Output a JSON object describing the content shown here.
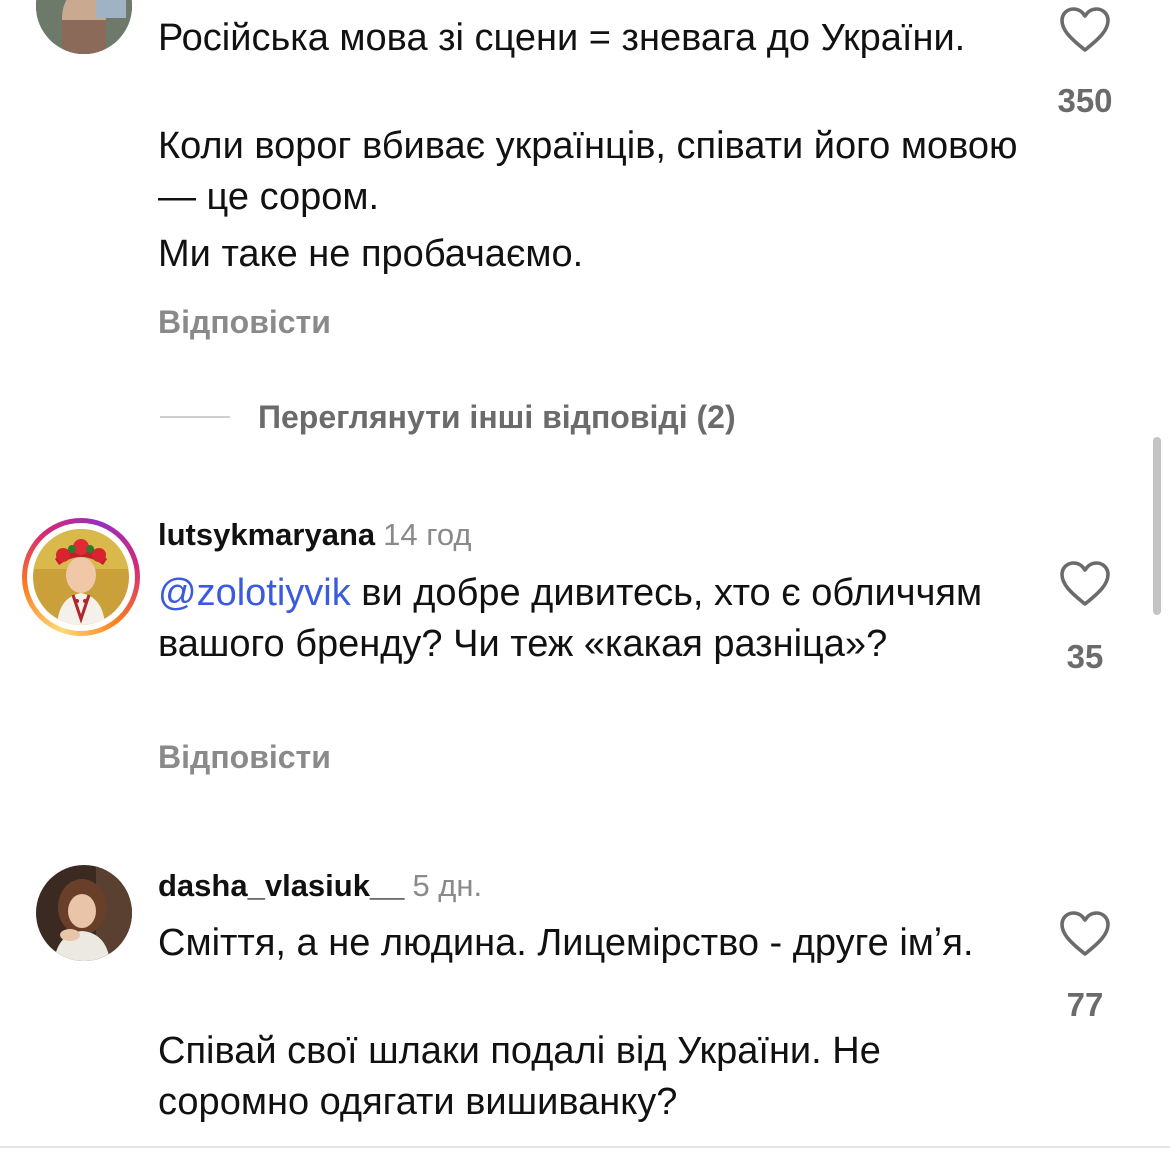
{
  "comments": [
    {
      "username": "",
      "time": "",
      "paragraphs": [
        "Російська мова зі сцени = зневага до України.",
        "Коли ворог вбиває українців, співати його мовою — це сором.",
        "Ми таке не пробачаємо."
      ],
      "reply_label": "Відповісти",
      "likes": "350",
      "like_icon": "heart-outline-icon",
      "view_replies": "Переглянути інші відповіді (2)"
    },
    {
      "username": "lutsykmaryana",
      "time": "14 год",
      "mention": "@zolotiyvik",
      "paragraphs": [
        " ви добре дивитесь, хто є обличчям вашого бренду? Чи теж «какая разніца»?"
      ],
      "reply_label": "Відповісти",
      "likes": "35",
      "like_icon": "heart-outline-icon",
      "has_story_ring": true
    },
    {
      "username": "dasha_vlasiuk__",
      "time": "5 дн.",
      "paragraphs": [
        "Сміття, а не людина. Лицемірство - друге імʼя.",
        "Співай свої шлаки подалі від України. Не соромно одягати вишиванку?"
      ],
      "likes": "77",
      "like_icon": "heart-outline-icon"
    }
  ],
  "colors": {
    "mention": "#3b5bdb",
    "secondary_text": "#8a8a8a",
    "story_ring": [
      "#feda75",
      "#fa7e1e",
      "#d62976",
      "#962fbf"
    ]
  }
}
